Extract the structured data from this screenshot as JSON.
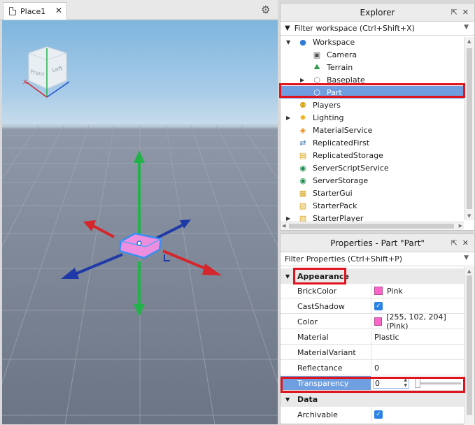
{
  "document_tab": {
    "label": "Place1",
    "close": "✕"
  },
  "explorer": {
    "title": "Explorer",
    "filter_placeholder": "Filter workspace (Ctrl+Shift+X)",
    "items": [
      {
        "label": "Workspace",
        "icon": "workspace-icon",
        "color": "#2f7bd6"
      },
      {
        "label": "Camera",
        "icon": "camera-icon",
        "color": "#555555"
      },
      {
        "label": "Terrain",
        "icon": "terrain-icon",
        "color": "#2e9a4a"
      },
      {
        "label": "Baseplate",
        "icon": "part-icon",
        "color": "#888888"
      },
      {
        "label": "Part",
        "icon": "part-icon",
        "color": "#ffffff"
      },
      {
        "label": "Players",
        "icon": "players-icon",
        "color": "#d7a51a"
      },
      {
        "label": "Lighting",
        "icon": "lighting-icon",
        "color": "#f0b21a"
      },
      {
        "label": "MaterialService",
        "icon": "material-service-icon",
        "color": "#e6891a"
      },
      {
        "label": "ReplicatedFirst",
        "icon": "replicated-first-icon",
        "color": "#3a6fb0"
      },
      {
        "label": "ReplicatedStorage",
        "icon": "replicated-storage-icon",
        "color": "#d7a51a"
      },
      {
        "label": "ServerScriptService",
        "icon": "server-script-service-icon",
        "color": "#1f8a4c"
      },
      {
        "label": "ServerStorage",
        "icon": "server-storage-icon",
        "color": "#1f8a4c"
      },
      {
        "label": "StarterGui",
        "icon": "starter-gui-icon",
        "color": "#d7a51a"
      },
      {
        "label": "StarterPack",
        "icon": "starter-pack-icon",
        "color": "#d7a51a"
      },
      {
        "label": "StarterPlayer",
        "icon": "starter-player-icon",
        "color": "#d7a51a"
      }
    ]
  },
  "properties": {
    "title": "Properties - Part \"Part\"",
    "filter_placeholder": "Filter Properties (Ctrl+Shift+P)",
    "sections": {
      "appearance": "Appearance",
      "data": "Data"
    },
    "rows": {
      "brick_color": {
        "name": "BrickColor",
        "value": "Pink"
      },
      "cast_shadow": {
        "name": "CastShadow",
        "checked": true
      },
      "color": {
        "name": "Color",
        "value": "[255, 102, 204] (Pink)"
      },
      "material": {
        "name": "Material",
        "value": "Plastic"
      },
      "material_variant": {
        "name": "MaterialVariant",
        "value": ""
      },
      "reflectance": {
        "name": "Reflectance",
        "value": "0"
      },
      "transparency": {
        "name": "Transparency",
        "value": "0"
      },
      "archivable": {
        "name": "Archivable",
        "checked": true
      }
    }
  },
  "viewcube": {
    "front": "Front",
    "left": "Left"
  },
  "colors": {
    "selection": "#6f9fe0",
    "highlight_box": "#e0141e",
    "part_color": "#ff66cc",
    "axis_x": "#d4262b",
    "axis_y": "#23b24a",
    "axis_z": "#1f3aa8"
  }
}
